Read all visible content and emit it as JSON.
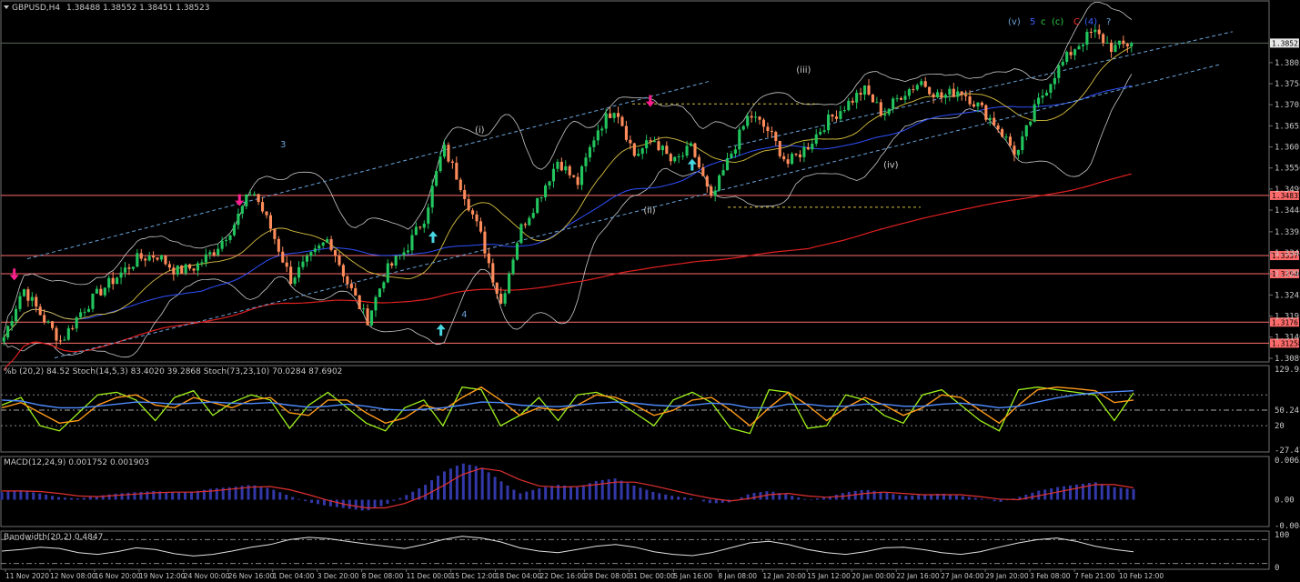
{
  "header": {
    "symbol": "GBPUSD,H4",
    "ohlc": "1.38488 1.38552 1.38451 1.38523"
  },
  "colors": {
    "background": "#000000",
    "bull_candle": "#22c55e",
    "bear_candle": "#ff8c5a",
    "ma_slow": "#e02020",
    "ma_mid": "#3050ff",
    "ma_fast": "#d8c040",
    "bollinger": "#c8c8c8",
    "hline": "#ff6b6b",
    "channel": "#6aa3d8",
    "stoch_fast": "#9ef01a",
    "stoch_slow": "#ff9a1a",
    "stoch_ma": "#4f8cff",
    "macd_hist": "#3338a8",
    "macd_signal": "#e03030",
    "bandwidth": "#e0e0e0",
    "sell_arrow": "#ff1f8f",
    "buy_arrow": "#49d6e0"
  },
  "chart_data": [
    {
      "type": "line",
      "panel": "price",
      "title": "GBPUSD,H4",
      "ylim": [
        1.30892,
        1.39082
      ],
      "y_ticks": [
        "1.38050",
        "1.37540",
        "1.37030",
        "1.36520",
        "1.36010",
        "1.35500",
        "1.34990",
        "1.34480",
        "1.33955",
        "1.33445",
        "1.32935",
        "1.32425",
        "1.31915",
        "1.31405",
        "1.30892"
      ],
      "x_labels": [
        "11 Nov 2020",
        "12 Nov 08:00",
        "16 Nov 20:00",
        "19 Nov 12:00",
        "24 Nov 00:00",
        "26 Nov 16:00",
        "1 Dec 04:00",
        "3 Dec 20:00",
        "8 Dec 08:00",
        "11 Dec 00:00",
        "15 Dec 12:00",
        "18 Dec 04:00",
        "22 Dec 16:00",
        "28 Dec 08:00",
        "31 Dec 00:00",
        "5 Jan 16:00",
        "8 Jan 08:00",
        "12 Jan 20:00",
        "15 Jan 12:00",
        "20 Jan 00:00",
        "22 Jan 16:00",
        "27 Jan 04:00",
        "29 Jan 20:00",
        "3 Feb 08:00",
        "7 Feb 21:00",
        "10 Feb 12:00"
      ],
      "close_path": [
        1.314,
        1.326,
        1.319,
        1.313,
        1.32,
        1.325,
        1.329,
        1.333,
        1.334,
        1.33,
        1.331,
        1.335,
        1.341,
        1.35,
        1.34,
        1.328,
        1.333,
        1.338,
        1.327,
        1.318,
        1.33,
        1.335,
        1.343,
        1.36,
        1.35,
        1.338,
        1.322,
        1.34,
        1.348,
        1.357,
        1.351,
        1.364,
        1.37,
        1.358,
        1.362,
        1.356,
        1.36,
        1.347,
        1.358,
        1.368,
        1.364,
        1.356,
        1.36,
        1.366,
        1.37,
        1.374,
        1.368,
        1.373,
        1.376,
        1.372,
        1.374,
        1.37,
        1.365,
        1.358,
        1.37,
        1.378,
        1.384,
        1.388,
        1.384,
        1.3852
      ],
      "horizontal_levels": [
        {
          "value": "1.34835",
          "label": "1.34835"
        },
        {
          "value": "1.33379",
          "label": "1.33379"
        },
        {
          "value": "1.32940",
          "label": "1.32940"
        },
        {
          "value": "1.31767",
          "label": "1.31767"
        },
        {
          "value": "1.31258",
          "label": "1.31258"
        }
      ],
      "current_price": "1.38523",
      "wave_labels": [
        {
          "text": "3",
          "x": 0.246,
          "y": 1.36,
          "color": "#6aa3d8"
        },
        {
          "text": "4",
          "x": 0.406,
          "y": 1.3188,
          "color": "#6aa3d8"
        },
        {
          "text": "(i)",
          "x": 0.418,
          "y": 1.3635,
          "color": "#cccccc"
        },
        {
          "text": "(ii)",
          "x": 0.567,
          "y": 1.344,
          "color": "#cccccc"
        },
        {
          "text": "(iii)",
          "x": 0.702,
          "y": 1.378,
          "color": "#cccccc"
        },
        {
          "text": "(iv)",
          "x": 0.779,
          "y": 1.355,
          "color": "#cccccc"
        }
      ],
      "wave_count": [
        {
          "text": "(v)",
          "color": "#6aa3d8"
        },
        {
          "text": "5",
          "color": "#3a60ff"
        },
        {
          "text": "c",
          "color": "#2ecc40"
        },
        {
          "text": "(c)",
          "color": "#2ecc40"
        },
        {
          "text": "C",
          "color": "#ff3030"
        },
        {
          "text": "(4)",
          "color": "#3a60ff"
        },
        {
          "text": "?",
          "color": "#6aa3d8"
        }
      ],
      "signals": [
        {
          "type": "sell",
          "x": 0.011,
          "y": 1.328
        },
        {
          "type": "sell",
          "x": 0.21,
          "y": 1.346
        },
        {
          "type": "buy",
          "x": 0.381,
          "y": 1.3395
        },
        {
          "type": "buy",
          "x": 0.388,
          "y": 1.317
        },
        {
          "type": "sell",
          "x": 0.573,
          "y": 1.37
        },
        {
          "type": "buy",
          "x": 0.61,
          "y": 1.357
        }
      ]
    },
    {
      "type": "line",
      "panel": "stochastic",
      "title": "%b (20,2) 84.52  Stoch(14,5,3) 83.4020 39.2868  Stoch(73,23,10) 70.0284 87.6902",
      "ylim": [
        -27.47,
        129.92
      ],
      "y_ticks": [
        "129.92",
        "50.24",
        "20",
        "-27.47"
      ],
      "series": [
        {
          "name": "Stoch fast",
          "values": [
            60,
            75,
            20,
            10,
            45,
            80,
            85,
            70,
            30,
            75,
            88,
            40,
            65,
            80,
            70,
            15,
            60,
            85,
            55,
            25,
            10,
            55,
            70,
            20,
            95,
            90,
            20,
            40,
            75,
            30,
            80,
            85,
            70,
            45,
            20,
            70,
            85,
            65,
            15,
            5,
            90,
            85,
            15,
            20,
            80,
            70,
            40,
            25,
            80,
            90,
            60,
            30,
            10,
            90,
            95,
            90,
            85,
            80,
            30,
            84
          ]
        },
        {
          "name": "Stoch slow",
          "values": [
            55,
            65,
            45,
            25,
            30,
            60,
            75,
            80,
            60,
            55,
            75,
            65,
            55,
            70,
            75,
            45,
            40,
            70,
            70,
            45,
            25,
            35,
            60,
            50,
            75,
            95,
            70,
            40,
            55,
            50,
            60,
            80,
            75,
            60,
            40,
            50,
            70,
            75,
            50,
            20,
            55,
            85,
            60,
            30,
            55,
            75,
            60,
            40,
            55,
            80,
            75,
            50,
            25,
            60,
            90,
            95,
            92,
            88,
            65,
            70
          ]
        },
        {
          "name": "Stoch MA",
          "values": [
            70,
            68,
            60,
            55,
            55,
            58,
            62,
            66,
            65,
            62,
            64,
            66,
            64,
            63,
            65,
            60,
            56,
            58,
            62,
            58,
            52,
            50,
            52,
            55,
            60,
            66,
            65,
            60,
            58,
            57,
            60,
            64,
            66,
            64,
            60,
            58,
            60,
            64,
            62,
            55,
            55,
            62,
            62,
            58,
            58,
            62,
            62,
            58,
            58,
            62,
            64,
            60,
            55,
            58,
            66,
            74,
            80,
            84,
            86,
            88
          ]
        }
      ]
    },
    {
      "type": "bar",
      "panel": "macd",
      "title": "MACD(12,24,9) 0.001752 0.001903",
      "ylim": [
        -0.004121,
        0.006301
      ],
      "y_ticks": [
        "0.006301",
        "0.00",
        "-0.004121"
      ],
      "series": [
        {
          "name": "MACD",
          "values": [
            0.0012,
            0.0015,
            0.001,
            0.0004,
            0.0002,
            0.0006,
            0.001,
            0.0012,
            0.0014,
            0.0011,
            0.0013,
            0.0018,
            0.002,
            0.0024,
            0.0018,
            0.0006,
            -0.0004,
            -0.001,
            -0.0014,
            -0.0018,
            -0.0008,
            0.0006,
            0.0022,
            0.0044,
            0.0058,
            0.0052,
            0.003,
            0.001,
            0.0018,
            0.0024,
            0.002,
            0.003,
            0.0034,
            0.0022,
            0.0012,
            0.0006,
            0.0002,
            -0.0006,
            -0.0004,
            0.001,
            0.0014,
            0.0008,
            0.0,
            0.0004,
            0.0012,
            0.0016,
            0.0012,
            0.0006,
            0.0008,
            0.001,
            0.0006,
            0.0002,
            -0.0004,
            0.0004,
            0.0014,
            0.002,
            0.0024,
            0.0028,
            0.002,
            0.0017
          ]
        },
        {
          "name": "Signal",
          "values": [
            0.0014,
            0.0014,
            0.0013,
            0.001,
            0.0006,
            0.0005,
            0.0007,
            0.0009,
            0.0011,
            0.0012,
            0.0012,
            0.0014,
            0.0017,
            0.002,
            0.0021,
            0.0016,
            0.0008,
            -0.0001,
            -0.0008,
            -0.0013,
            -0.0013,
            -0.0006,
            0.0006,
            0.0022,
            0.004,
            0.005,
            0.0046,
            0.0032,
            0.0022,
            0.002,
            0.0021,
            0.0024,
            0.0028,
            0.0028,
            0.0022,
            0.0015,
            0.0008,
            0.0002,
            -0.0002,
            0.0002,
            0.0008,
            0.001,
            0.0006,
            0.0004,
            0.0006,
            0.001,
            0.0012,
            0.001,
            0.0008,
            0.0008,
            0.0008,
            0.0005,
            0.0001,
            0.0,
            0.0006,
            0.0012,
            0.0018,
            0.0024,
            0.0024,
            0.0019
          ]
        }
      ]
    },
    {
      "type": "line",
      "panel": "bandwidth",
      "title": "Bandwidth(20,2) 0.4847",
      "ylim": [
        0,
        100
      ],
      "y_ticks": [
        "100",
        "0"
      ],
      "series": [
        {
          "name": "Bandwidth",
          "values": [
            50,
            55,
            62,
            58,
            45,
            40,
            48,
            60,
            55,
            42,
            35,
            40,
            50,
            62,
            70,
            85,
            92,
            88,
            80,
            72,
            65,
            58,
            70,
            85,
            95,
            90,
            78,
            60,
            50,
            45,
            55,
            65,
            70,
            62,
            48,
            40,
            36,
            45,
            60,
            75,
            80,
            70,
            55,
            45,
            40,
            48,
            60,
            62,
            55,
            45,
            40,
            48,
            62,
            75,
            85,
            90,
            80,
            65,
            55,
            48
          ]
        }
      ]
    }
  ]
}
